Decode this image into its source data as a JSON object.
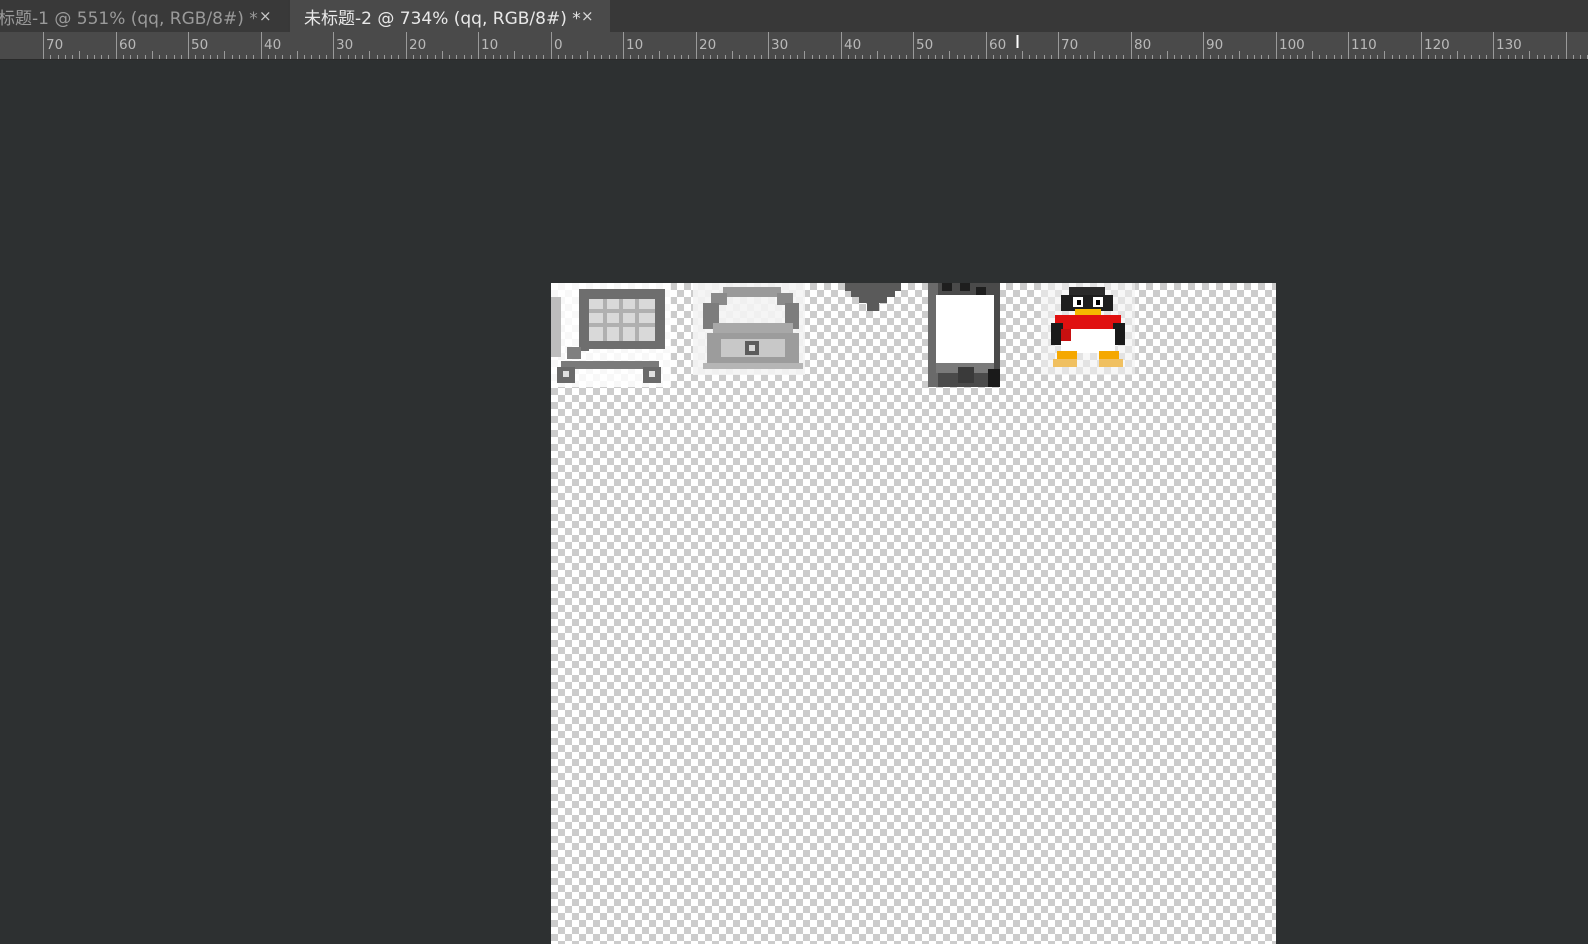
{
  "tabs": [
    {
      "title": "标题-1 @ 551% (qq, RGB/8#) *",
      "close": "×",
      "active": false
    },
    {
      "title": "未标题-2 @ 734% (qq, RGB/8#) *",
      "close": "×",
      "active": true
    }
  ],
  "ruler": {
    "labels": [
      "70",
      "60",
      "50",
      "40",
      "30",
      "20",
      "10",
      "0",
      "10",
      "20",
      "30",
      "40",
      "50",
      "60",
      "70",
      "80",
      "90",
      "100",
      "110",
      "120",
      "130"
    ]
  },
  "canvas": {
    "sprites": [
      "cart-icon",
      "phone-receiver-icon",
      "triangle-down-icon",
      "mobile-phone-icon",
      "qq-penguin-icon"
    ]
  },
  "colors": {
    "workspace": "#2d3031",
    "tabbar": "#383838",
    "active_tab": "#4a4a4a",
    "ruler": "#4a4a4a",
    "checker_light": "#ffffff",
    "checker_dark": "#cccccc"
  }
}
